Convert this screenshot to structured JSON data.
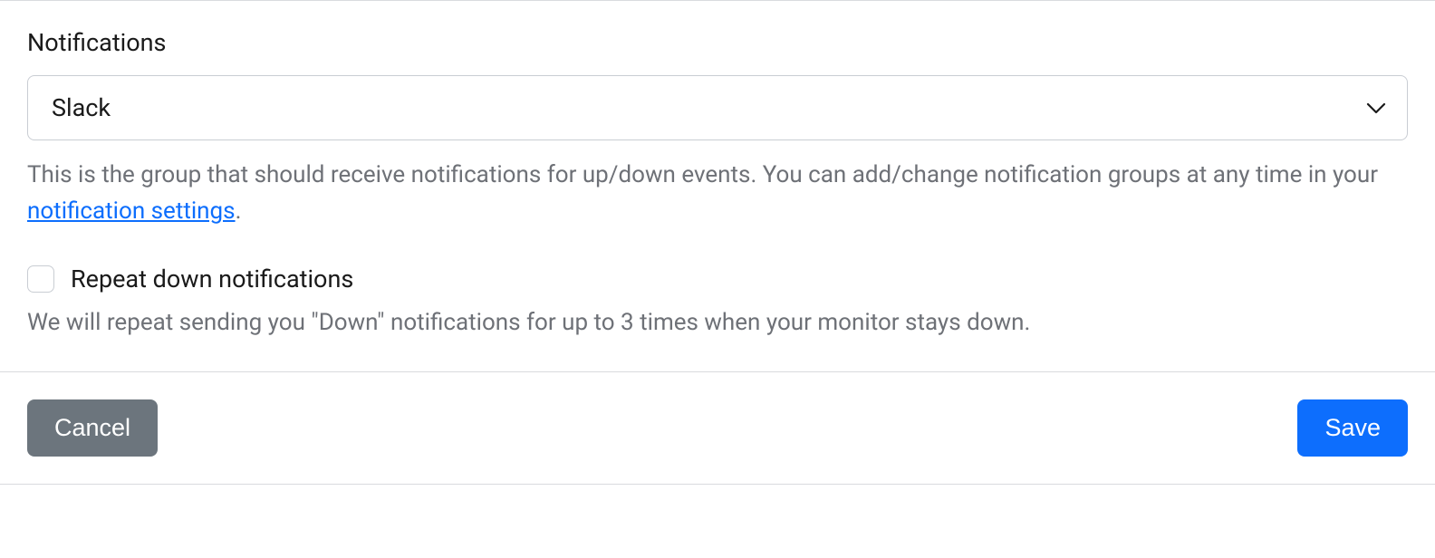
{
  "notifications": {
    "label": "Notifications",
    "selected": "Slack",
    "help_prefix": "This is the group that should receive notifications for up/down events. You can add/change notification groups at any time in your ",
    "help_link": "notification settings",
    "help_suffix": ".",
    "repeat_label": "Repeat down notifications",
    "repeat_help": "We will repeat sending you \"Down\" notifications for up to 3 times when your monitor stays down."
  },
  "footer": {
    "cancel": "Cancel",
    "save": "Save"
  }
}
